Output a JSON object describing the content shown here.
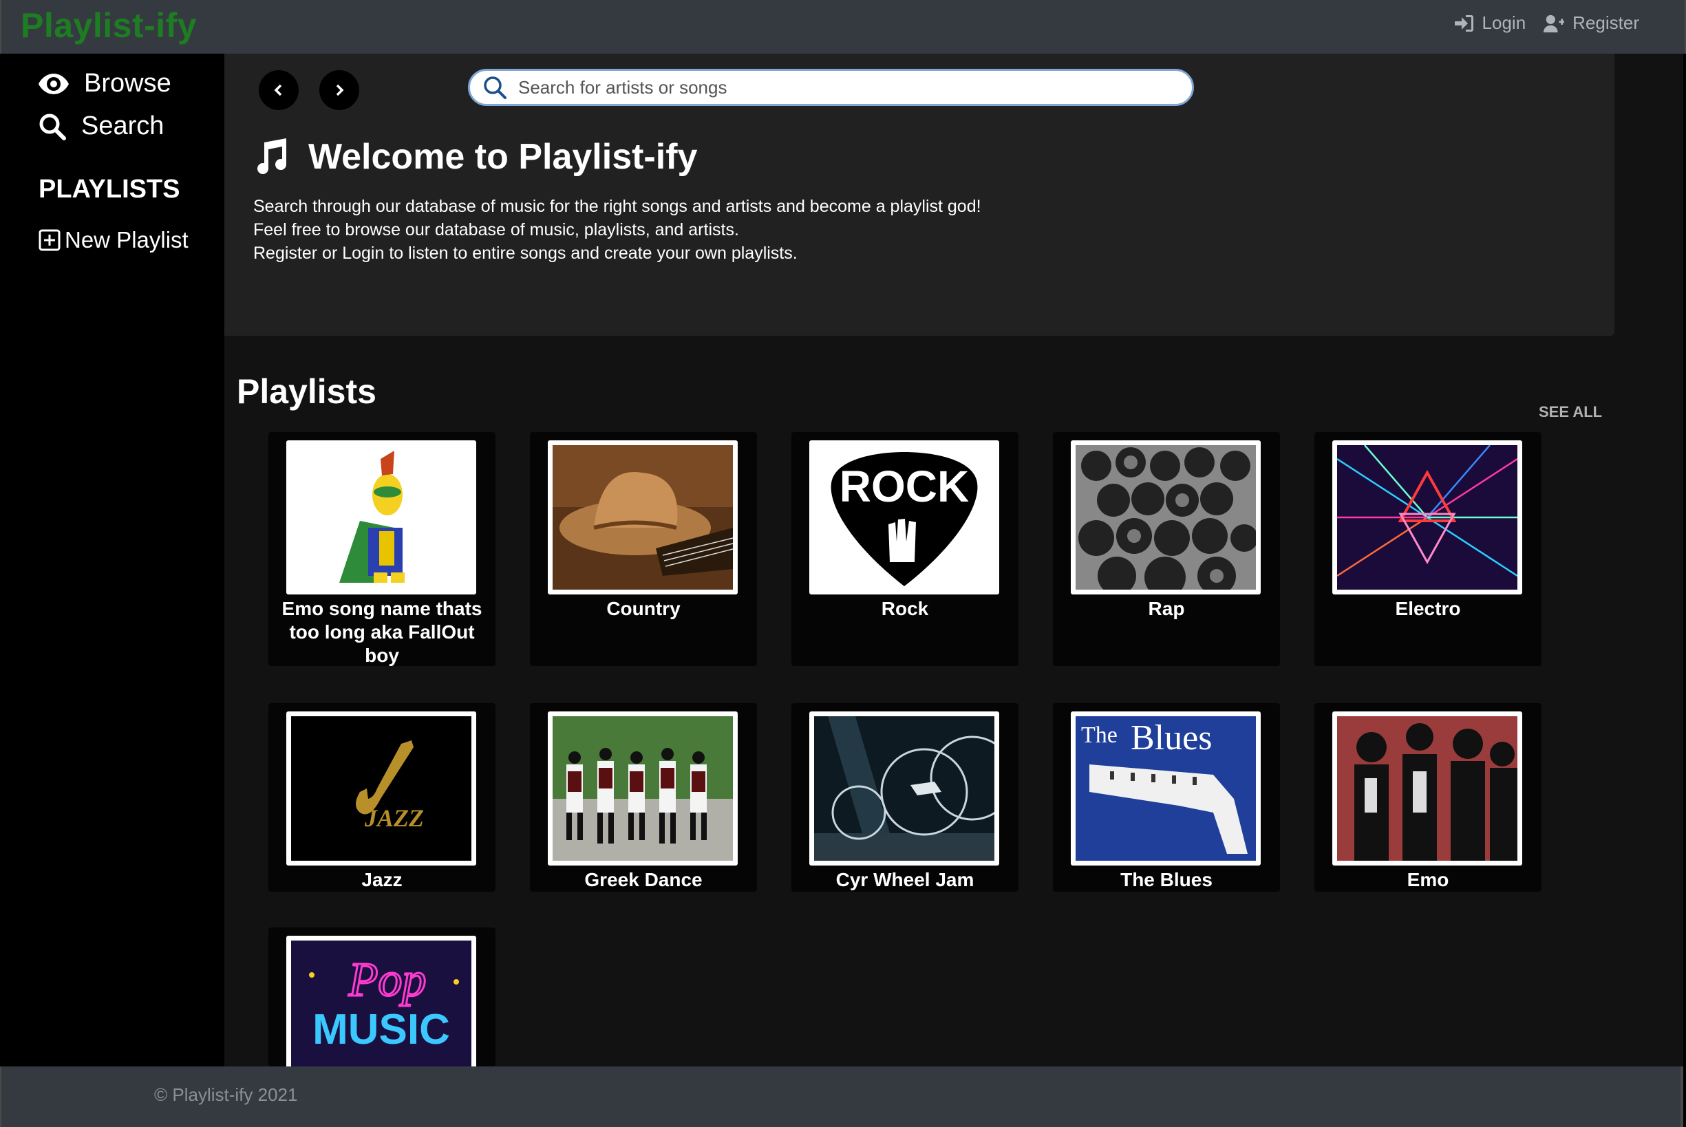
{
  "navbar": {
    "brand": "Playlist-ify",
    "login_label": "Login",
    "register_label": "Register"
  },
  "sidebar": {
    "browse_label": "Browse",
    "search_label": "Search",
    "playlists_heading": "PLAYLISTS",
    "new_playlist_label": "New Playlist"
  },
  "search": {
    "placeholder": "Search for artists or songs",
    "value": ""
  },
  "hero": {
    "title": "Welcome to Playlist-ify",
    "lines": [
      "Search through our database of music for the right songs and artists and become a playlist god!",
      "Feel free to browse our database of music, playlists, and artists.",
      "Register or Login to listen to entire songs and create your own playlists."
    ]
  },
  "playlists": {
    "heading": "Playlists",
    "see_all": "SEE ALL",
    "items": [
      {
        "title": "Emo song name thats too long aka FallOut boy"
      },
      {
        "title": "Country"
      },
      {
        "title": "Rock",
        "art_text": "ROCK"
      },
      {
        "title": "Rap"
      },
      {
        "title": "Electro"
      },
      {
        "title": "Jazz",
        "art_text": "JAZZ"
      },
      {
        "title": "Greek Dance"
      },
      {
        "title": "Cyr Wheel Jam"
      },
      {
        "title": "The Blues",
        "art_text_1": "The",
        "art_text_2": "Blues"
      },
      {
        "title": "Emo"
      },
      {
        "title": "",
        "art_text_1": "Pop",
        "art_text_2": "MUSIC"
      }
    ]
  },
  "footer": {
    "copyright": "© Playlist-ify 2021"
  },
  "colors": {
    "brand": "#1e7d22",
    "navbar": "#343a40",
    "hero_bg": "#212121",
    "main_bg": "#121212"
  }
}
